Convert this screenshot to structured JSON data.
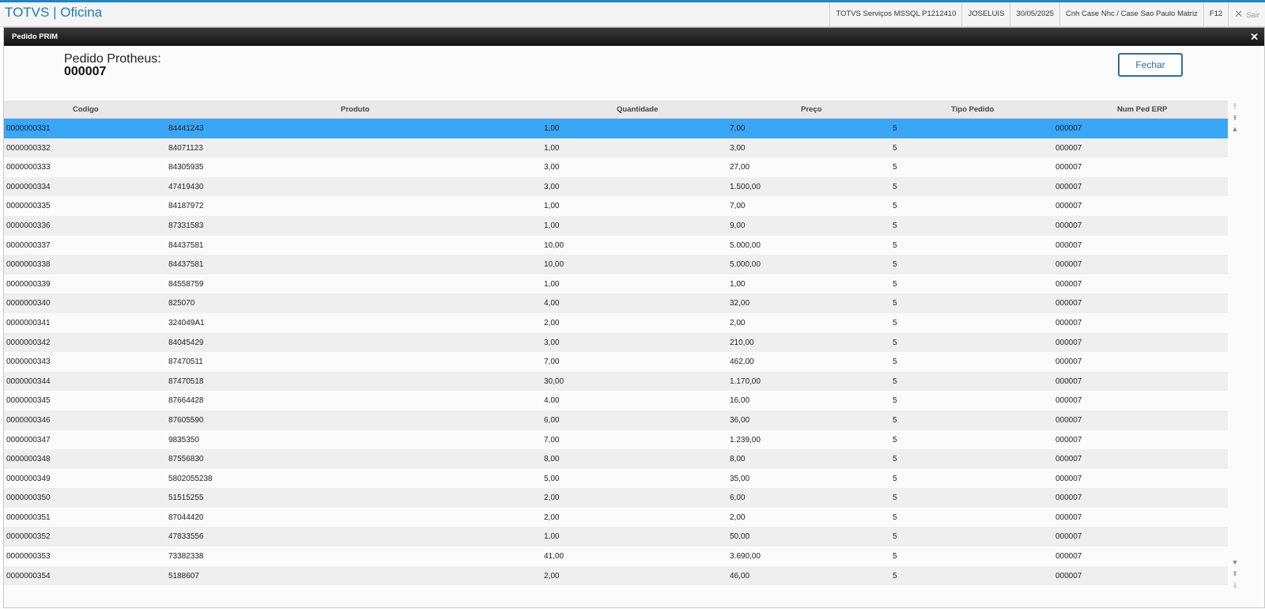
{
  "app": {
    "brand": "TOTVS | Oficina",
    "environment": "TOTVS Serviços MSSQL P1212410",
    "user": "JOSELUIS",
    "date": "30/05/2025",
    "branch": "Cnh Case Nhc / Case Sao Paulo Matriz",
    "shortcut": "F12",
    "exit_label": "Sair"
  },
  "dialog": {
    "title": "Pedido PRIM",
    "order_label": "Pedido Protheus:",
    "order_number": "000007",
    "close_button": "Fechar"
  },
  "grid": {
    "columns": [
      "Codigo",
      "Produto",
      "Quantidade",
      "Preço",
      "Tipo Pedido",
      "Num Ped ERP"
    ],
    "selected_row": 0,
    "rows": [
      [
        "0000000331",
        "84441243",
        "1,00",
        "7,00",
        "5",
        "000007"
      ],
      [
        "0000000332",
        "84071123",
        "1,00",
        "3,00",
        "5",
        "000007"
      ],
      [
        "0000000333",
        "84305935",
        "3,00",
        "27,00",
        "5",
        "000007"
      ],
      [
        "0000000334",
        "47419430",
        "3,00",
        "1.500,00",
        "5",
        "000007"
      ],
      [
        "0000000335",
        "84187972",
        "1,00",
        "7,00",
        "5",
        "000007"
      ],
      [
        "0000000336",
        "87331583",
        "1,00",
        "9,00",
        "5",
        "000007"
      ],
      [
        "0000000337",
        "84437581",
        "10,00",
        "5.000,00",
        "5",
        "000007"
      ],
      [
        "0000000338",
        "84437581",
        "10,00",
        "5.000,00",
        "5",
        "000007"
      ],
      [
        "0000000339",
        "84558759",
        "1,00",
        "1,00",
        "5",
        "000007"
      ],
      [
        "0000000340",
        "825070",
        "4,00",
        "32,00",
        "5",
        "000007"
      ],
      [
        "0000000341",
        "324049A1",
        "2,00",
        "2,00",
        "5",
        "000007"
      ],
      [
        "0000000342",
        "84045429",
        "3,00",
        "210,00",
        "5",
        "000007"
      ],
      [
        "0000000343",
        "87470511",
        "7,00",
        "462,00",
        "5",
        "000007"
      ],
      [
        "0000000344",
        "87470518",
        "30,00",
        "1.170,00",
        "5",
        "000007"
      ],
      [
        "0000000345",
        "87664428",
        "4,00",
        "16,00",
        "5",
        "000007"
      ],
      [
        "0000000346",
        "87605590",
        "6,00",
        "36,00",
        "5",
        "000007"
      ],
      [
        "0000000347",
        "9835350",
        "7,00",
        "1.239,00",
        "5",
        "000007"
      ],
      [
        "0000000348",
        "87556830",
        "8,00",
        "8,00",
        "5",
        "000007"
      ],
      [
        "0000000349",
        "5802055238",
        "5,00",
        "35,00",
        "5",
        "000007"
      ],
      [
        "0000000350",
        "51515255",
        "2,00",
        "6,00",
        "5",
        "000007"
      ],
      [
        "0000000351",
        "87044420",
        "2,00",
        "2,00",
        "5",
        "000007"
      ],
      [
        "0000000352",
        "47833556",
        "1,00",
        "50,00",
        "5",
        "000007"
      ],
      [
        "0000000353",
        "73382338",
        "41,00",
        "3.690,00",
        "5",
        "000007"
      ],
      [
        "0000000354",
        "5188607",
        "2,00",
        "46,00",
        "5",
        "000007"
      ]
    ]
  },
  "icons": {
    "close_dialog": "close-icon",
    "exit": "close-icon",
    "scroll_top": "scroll-top-icon",
    "scroll_page_up": "scroll-page-up-icon",
    "scroll_up": "scroll-up-icon",
    "scroll_down": "scroll-down-icon",
    "scroll_page_down": "scroll-page-down-icon",
    "scroll_bottom": "scroll-bottom-icon"
  },
  "colors": {
    "brand": "#1f7ab8",
    "selected_row": "#39a6f6",
    "title_bar": "#1a1a1a",
    "button_border": "#2a6f9e"
  }
}
